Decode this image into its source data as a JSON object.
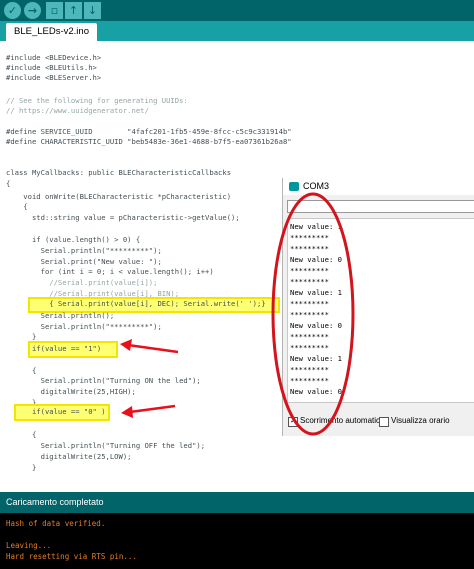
{
  "toolbar": {
    "buttons": [
      "verify-icon",
      "upload-icon",
      "new-icon",
      "open-icon",
      "save-icon"
    ],
    "colors": {
      "bar": "#006468",
      "button": "#4db7bb"
    }
  },
  "tab": {
    "label": "BLE_LEDs-v2.ino"
  },
  "editor": {
    "lines": [
      "#include <BLEDevice.h>",
      "#include <BLEUtils.h>",
      "#include <BLEServer.h>",
      "",
      "// See the following for generating UUIDs:",
      "// https://www.uuidgenerator.net/",
      "",
      "#define SERVICE_UUID        \"4fafc201-1fb5-459e-8fcc-c5c9c331914b\"",
      "#define CHARACTERISTIC_UUID \"beb5483e-36e1-4688-b7f5-ea07361b26a8\"",
      "",
      "",
      "class MyCallbacks: public BLECharacteristicCallbacks",
      "{",
      "    void onWrite(BLECharacteristic *pCharacteristic)",
      "    {",
      "      std::string value = pCharacteristic->getValue();",
      "",
      "      if (value.length() > 0) {",
      "        Serial.println(\"*********\");",
      "        Serial.print(\"New value: \");",
      "        for (int i = 0; i < value.length(); i++)",
      "          //Serial.print(value[i]);",
      "          //Serial.print(value[i], BIN);",
      "          { Serial.print(value[i], DEC); Serial.write(' ');}",
      "        Serial.println();",
      "        Serial.println(\"*********\");",
      "      }",
      "      if(value == \"1\")",
      "",
      "      {",
      "        Serial.println(\"Turning ON the led\");",
      "        digitalWrite(25,HIGH);",
      "      }",
      "      if(value == \"0\" )",
      "",
      "      {",
      "        Serial.println(\"Turning OFF the led\");",
      "        digitalWrite(25,LOW);",
      "      }"
    ]
  },
  "serial_monitor": {
    "title": "COM3",
    "output_lines": [
      "New value: 1",
      "*********",
      "*********",
      "New value: 0",
      "*********",
      "*********",
      "New value: 1",
      "*********",
      "*********",
      "New value: 0",
      "*********",
      "*********",
      "New value: 1",
      "*********",
      "*********",
      "New value: 0"
    ],
    "autoscroll_label": "Scorrimento automatico",
    "autoscroll_checked": true,
    "timestamp_label": "Visualizza orario",
    "timestamp_checked": false
  },
  "status": {
    "text": "Caricamento completato"
  },
  "console": {
    "lines": [
      "Hash of data verified.",
      "",
      "Leaving...",
      "Hard resetting via RTS pin..."
    ]
  },
  "annotation_colors": {
    "highlight": "#ffff00",
    "arrow": "#e8101a",
    "ellipse": "#d4141c"
  }
}
